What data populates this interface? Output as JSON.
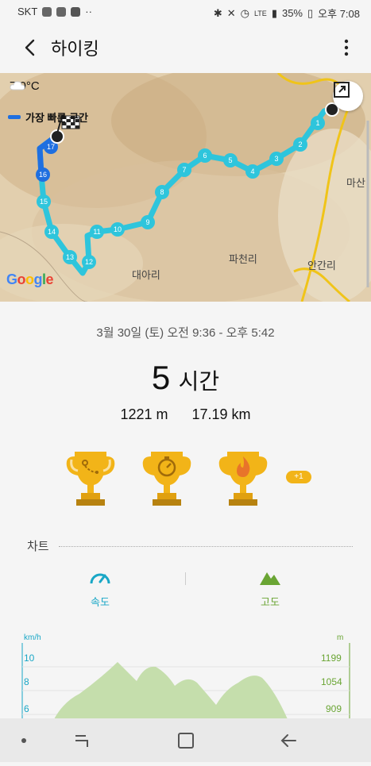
{
  "status": {
    "carrier": "SKT",
    "battery": "35%",
    "time": "오후 7:08",
    "network": "LTE"
  },
  "appbar": {
    "title": "하이킹"
  },
  "map": {
    "temperature": "7.0°C",
    "route_label": "가장 빠른 구간",
    "places": [
      "대아리",
      "파천리",
      "안간리",
      "마산"
    ],
    "markers": [
      "1",
      "2",
      "3",
      "4",
      "5",
      "6",
      "7",
      "8",
      "9",
      "10",
      "11",
      "12",
      "13",
      "14",
      "15",
      "16",
      "17"
    ]
  },
  "summary": {
    "datetime": "3월 30일 (토) 오전 9:36 - 오후 5:42",
    "duration_value": "5",
    "duration_unit": "시간",
    "elevation": "1221 m",
    "distance": "17.19 km",
    "extra_badge": "+1"
  },
  "chart_section": {
    "title": "차트",
    "tab_speed": "속도",
    "tab_altitude": "고도"
  },
  "chart_data": {
    "type": "area",
    "left_unit": "km/h",
    "right_unit": "m",
    "left_ticks": [
      "10",
      "8",
      "6"
    ],
    "right_ticks": [
      "1199",
      "1054",
      "909"
    ]
  },
  "colors": {
    "accent_speed": "#19a7c6",
    "accent_altitude": "#6aa534",
    "route": "#2ec5dc",
    "trophy": "#f2b418"
  }
}
